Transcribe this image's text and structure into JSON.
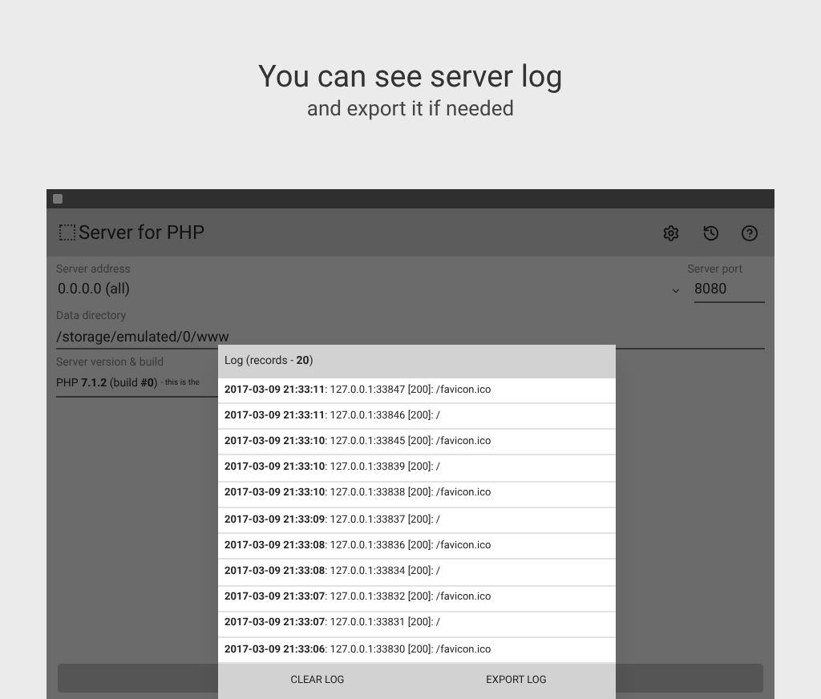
{
  "headline": {
    "title": "You can see server log",
    "subtitle": "and export it if needed"
  },
  "app": {
    "title": "Server for PHP",
    "fields": [
      {
        "label": "Server address",
        "value": "0.0.0.0 (all)"
      },
      {
        "label": "Server port",
        "value": "8080"
      },
      {
        "label": "Data directory",
        "value": "/storage/emulated/0/www"
      },
      {
        "label": "Server version & build",
        "value": "PHP **7.1.2** (build **#0**)",
        "note": "- this is the"
      }
    ]
  },
  "dialog": {
    "title": "Log (records - **20**)",
    "rows": [
      "**2017-03-09 21:33:11**: 127.0.0.1:33847 [200]: /favicon.ico",
      "**2017-03-09 21:33:11**: 127.0.0.1:33846 [200]: /",
      "**2017-03-09 21:33:10**: 127.0.0.1:33845 [200]: /favicon.ico",
      "**2017-03-09 21:33:10**: 127.0.0.1:33839 [200]: /",
      "**2017-03-09 21:33:10**: 127.0.0.1:33838 [200]: /favicon.ico",
      "**2017-03-09 21:33:09**: 127.0.0.1:33837 [200]: /",
      "**2017-03-09 21:33:08**: 127.0.0.1:33836 [200]: /favicon.ico",
      "**2017-03-09 21:33:08**: 127.0.0.1:33834 [200]: /",
      "**2017-03-09 21:33:07**: 127.0.0.1:33832 [200]: /favicon.ico",
      "**2017-03-09 21:33:07**: 127.0.0.1:33831 [200]: /",
      "**2017-03-09 21:33:06**: 127.0.0.1:33830 [200]: /favicon.ico"
    ],
    "buttons": [
      "CLEAR LOG",
      "EXPORT LOG"
    ]
  }
}
